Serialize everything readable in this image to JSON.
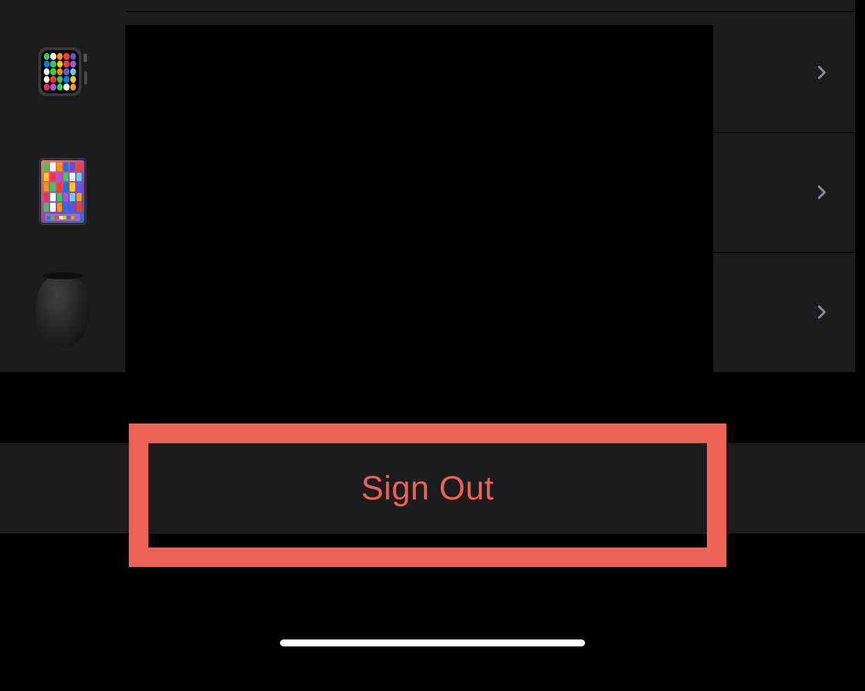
{
  "devices": {
    "apple_watch": {
      "name": "apple-watch-device",
      "icon_colors": [
        "#34c759",
        "#ffffff",
        "#ff9500",
        "#ff3b30",
        "#5856d6",
        "#007aff",
        "#34c759",
        "#ffcc00",
        "#ff2d55",
        "#af52de",
        "#ffffff",
        "#30d158",
        "#ff9500",
        "#5e5ce6",
        "#64d2ff",
        "#ffffff",
        "#ff3b30",
        "#34c759",
        "#007aff",
        "#ffcc00",
        "#ff2d55",
        "#af52de",
        "#32d74b",
        "#ffffff",
        "#ff9f0a"
      ]
    },
    "ipad": {
      "name": "ipad-device",
      "app_colors": [
        "#34c759",
        "#ffffff",
        "#ff9500",
        "#007aff",
        "#5856d6",
        "#ff3b30",
        "#ffcc00",
        "#ff2d55",
        "#af52de",
        "#30d158",
        "#ffffff",
        "#64d2ff",
        "#ff9500",
        "#34c759",
        "#ff3b30",
        "#007aff",
        "#ffcc00",
        "#5e5ce6",
        "#ff2d55",
        "#ffffff",
        "#30d158",
        "#af52de",
        "#64d2ff",
        "#ff9f0a",
        "#34c759",
        "#ffffff",
        "#ff9500",
        "#007aff",
        "#5856d6",
        "#ff3b30"
      ],
      "dock_colors": [
        "#007aff",
        "#34c759",
        "#ff3b30",
        "#ffffff",
        "#ffcc00",
        "#5856d6",
        "#ff9500",
        "#af52de"
      ]
    },
    "homepod": {
      "name": "homepod-device"
    }
  },
  "actions": {
    "sign_out_label": "Sign Out"
  },
  "colors": {
    "highlight": "#ed6256",
    "destructive": "#ed6256",
    "panel_bg": "#1c1c1e",
    "chevron": "#8e8e93"
  }
}
